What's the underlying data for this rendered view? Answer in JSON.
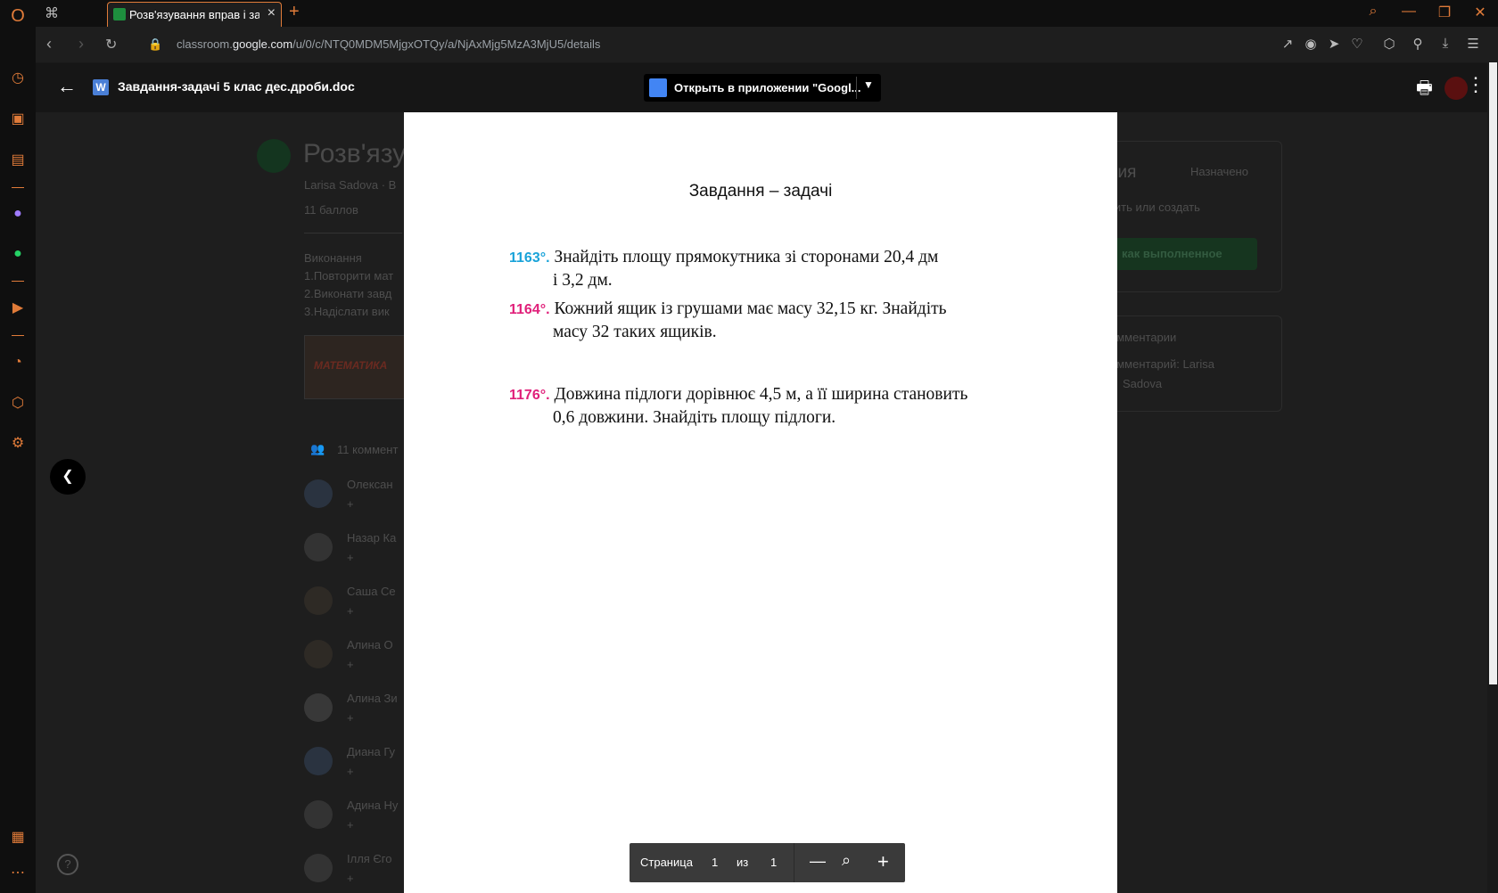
{
  "browser": {
    "tab_title": "Розв'язування вправ і задач",
    "url_prefix": "classroom.",
    "url_domain": "google.com",
    "url_path": "/u/0/c/NTQ0MDM5MjgxOTQy/a/NjAxMjg5MzA3MjU5/details"
  },
  "viewer": {
    "file_name": "Завдання-задачі 5 клас дес.дроби.doc",
    "open_in_app_label": "Открыть в приложении \"Googl..."
  },
  "document": {
    "title": "Завдання – задачі",
    "tasks": [
      {
        "number": "1163°.",
        "line1": "Знайдіть площу прямокутника зі сторонами 20,4 дм",
        "line2": "і 3,2 дм."
      },
      {
        "number": "1164°.",
        "line1": "Кожний ящик із грушами має масу 32,15 кг. Знайдіть",
        "line2": "масу 32 таких ящиків."
      },
      {
        "number": "1176°.",
        "line1": "Довжина підлоги дорівнює 4,5 м, а її ширина становить",
        "line2": "0,6 довжини. Знайдіть площу підлоги."
      }
    ]
  },
  "page_controls": {
    "page_label": "Страница",
    "current_page": "1",
    "of_label": "из",
    "total_pages": "1"
  },
  "background": {
    "assignment_title": "Розв'язу",
    "author": "Larisa Sadova · В",
    "points": "11 баллов",
    "desc_0": "Виконання",
    "desc_1": "1.Повторити мат",
    "desc_2": "2.Виконати завд",
    "desc_3": "3.Надіслати вик",
    "thumb_label": "МАТЕМАТИКА",
    "comments_count": "11 коммент",
    "students": [
      "Олексан",
      "Назар Ка",
      "Саша Се",
      "Алина О",
      "Алина Зи",
      "Диана Гу",
      "Адина Ну",
      "Ілля Єго"
    ],
    "plus": "+",
    "right_title": "ния",
    "right_status": "Назначено",
    "right_add": "вить или создать",
    "right_done": "как выполненное",
    "private_comments": "омментарии",
    "private_comments_2": "омментарий: Larisa",
    "private_comments_3": "Sadova"
  },
  "colors": {
    "accent": "#e07b39",
    "task_blue": "#1aa3d9",
    "task_pink": "#e0207a"
  }
}
